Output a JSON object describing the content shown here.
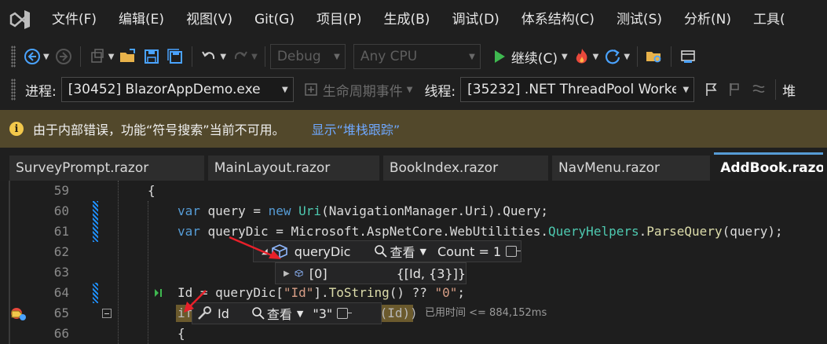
{
  "menu": {
    "items": [
      "文件(F)",
      "编辑(E)",
      "视图(V)",
      "Git(G)",
      "项目(P)",
      "生成(B)",
      "调试(D)",
      "体系结构(C)",
      "测试(S)",
      "分析(N)",
      "工具("
    ]
  },
  "toolbar": {
    "config": "Debug",
    "platform": "Any CPU",
    "continue_label": "继续(C)"
  },
  "debugbar": {
    "process_label": "进程:",
    "process_value": "[30452] BlazorAppDemo.exe",
    "lifecycle_label": "生命周期事件",
    "thread_label": "线程:",
    "thread_value": "[35232] .NET ThreadPool Worke",
    "stack_label": "堆"
  },
  "infobar": {
    "message": "由于内部错误，功能“符号搜索”当前不可用。",
    "link": "显示“堆栈跟踪”"
  },
  "tabs": [
    "SurveyPrompt.razor",
    "MainLayout.razor",
    "BookIndex.razor",
    "NavMenu.razor",
    "AddBook.razo"
  ],
  "editor": {
    "line_numbers": [
      "59",
      "60",
      "61",
      "62",
      "63",
      "64",
      "65",
      "66"
    ],
    "line59": "{",
    "line60_a": "var",
    "line60_b": " query = ",
    "line60_c": "new",
    "line60_d": " ",
    "line60_e": "Uri",
    "line60_f": "(NavigationManager.Uri).Query;",
    "line61_a": "var",
    "line61_b": " queryDic = Microsoft.AspNetCore.WebUtilities.",
    "line61_c": "QueryHelpers",
    "line61_d": ".",
    "line61_e": "ParseQuery",
    "line61_f": "(query);",
    "line64_a": "Id = queryDic[",
    "line64_b": "\"Id\"",
    "line64_c": "].",
    "line64_d": "ToString",
    "line64_e": "() ?? ",
    "line64_f": "\"0\"",
    "line64_g": ";",
    "line65_a": "if",
    "line65_b": "y(Id))",
    "line66": "{",
    "elapsed": "已用时间 <= 884,152ms"
  },
  "datatip1": {
    "name": "queryDic",
    "view_label": "查看",
    "value": "Count = 1",
    "child_name": "[0]",
    "child_value": "{[Id, {3}]}"
  },
  "datatip2": {
    "name": "Id",
    "view_label": "查看",
    "value": "\"3\""
  },
  "colors": {
    "infobar_bg": "#52482b",
    "accent": "#569cd6",
    "link": "#6fa8ff",
    "continue_green": "#3fb950"
  }
}
